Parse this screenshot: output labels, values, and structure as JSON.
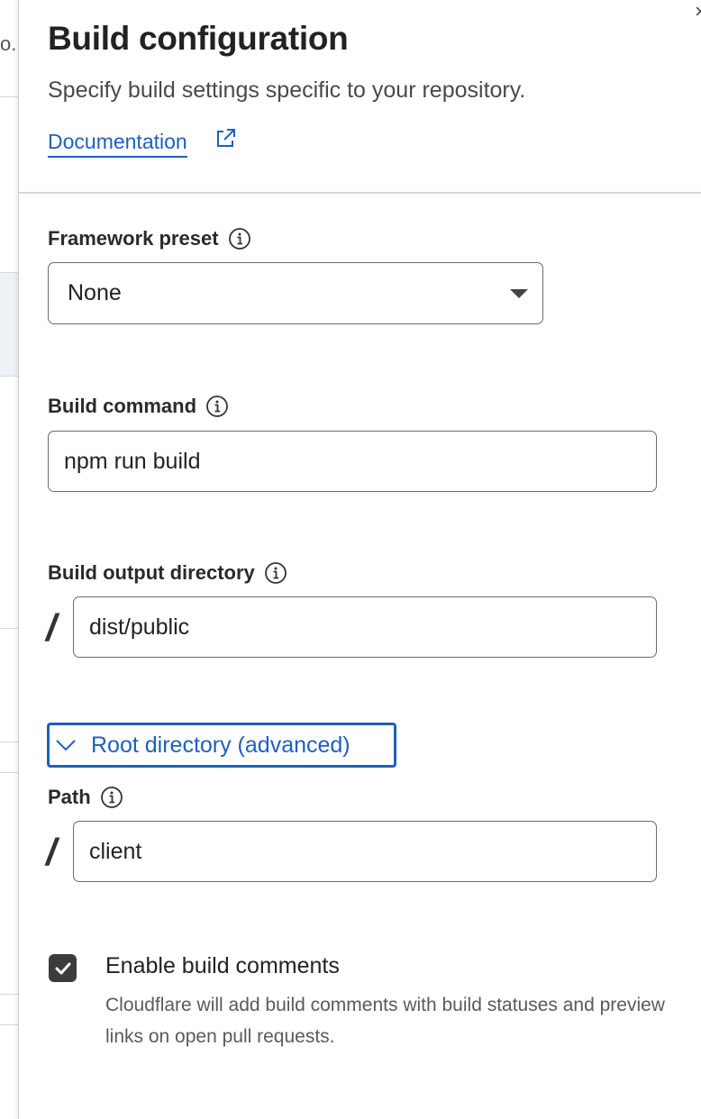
{
  "backdrop": {
    "breadcrumb_fragment": "o."
  },
  "panel": {
    "close_glyph": "×",
    "title": "Build configuration",
    "subtitle": "Specify build settings specific to your repository.",
    "documentation_link": "Documentation",
    "documentation_icon": "external-link-icon"
  },
  "form": {
    "framework_preset": {
      "label": "Framework preset",
      "info_icon": "info-icon",
      "selected": "None"
    },
    "build_command": {
      "label": "Build command",
      "info_icon": "info-icon",
      "value": "npm run build"
    },
    "build_output_directory": {
      "label": "Build output directory",
      "info_icon": "info-icon",
      "prefix": "/",
      "value": "dist/public"
    },
    "root_directory": {
      "toggle_label": "Root directory (advanced)",
      "toggle_icon": "chevron-down-icon",
      "path_label": "Path",
      "info_icon": "info-icon",
      "prefix": "/",
      "value": "client"
    },
    "build_comments": {
      "checked": true,
      "label": "Enable build comments",
      "description": "Cloudflare will add build comments with build statuses and preview links on open pull requests."
    }
  },
  "colors": {
    "link": "#1f5fbf",
    "checkbox": "#3c3c3c",
    "border": "#6b6b6b",
    "divider": "#d9d9d9"
  }
}
